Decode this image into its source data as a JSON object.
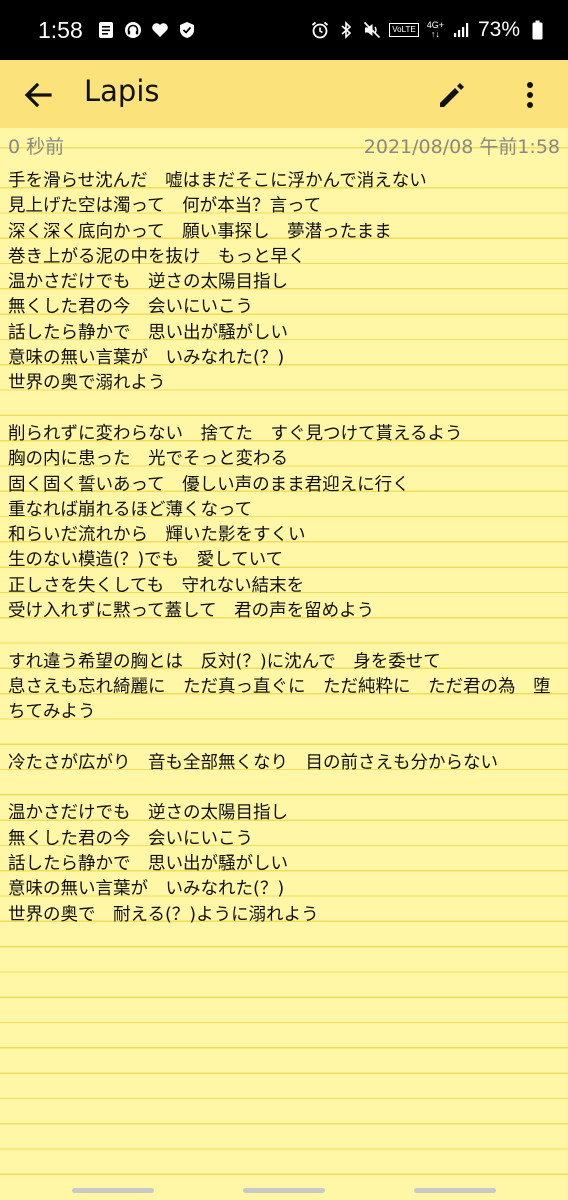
{
  "status_bar": {
    "time": "1:58",
    "battery_text": "73%",
    "volte": "VoLTE",
    "network_type": "4G+",
    "network_arrows": "↑↓",
    "left_icons": [
      "notes-icon",
      "headset-icon",
      "heart-icon",
      "shield-icon"
    ],
    "right_icons": [
      "alarm-icon",
      "bluetooth-icon",
      "mute-icon",
      "signal-icon",
      "battery-icon"
    ]
  },
  "toolbar": {
    "title": "Lapis",
    "bg_color": "#fbe27a"
  },
  "note": {
    "modified": "0 秒前",
    "created": "2021/08/08 午前1:58",
    "bg_color": "#fff7a6",
    "line_color": "#f0dd5a",
    "body": "手を滑らせ沈んだ　嘘はまだそこに浮かんで消えない\n見上げた空は濁って　何が本当？言って\n深く深く底向かって　願い事探し　夢潜ったまま\n巻き上がる泥の中を抜け　もっと早く\n温かさだけでも　逆さの太陽目指し\n無くした君の今　会いにいこう\n話したら静かで　思い出が騒がしい\n意味の無い言葉が　いみなれた(？)\n世界の奥で溺れよう\n\n削られずに変わらない　捨てた　すぐ見つけて貰えるよう\n胸の内に患った　光でそっと変わる\n固く固く誓いあって　優しい声のまま君迎えに行く\n重なれば崩れるほど薄くなって\n和らいだ流れから　輝いた影をすくい\n生のない模造(？)でも　愛していて\n正しさを失くしても　守れない結末を\n受け入れずに黙って蓋して　君の声を留めよう\n\nすれ違う希望の胸とは　反対(？)に沈んで　身を委せて\n息さえも忘れ綺麗に　ただ真っ直ぐに　ただ純粋に　ただ君の為　堕ちてみよう\n\n冷たさが広がり　音も全部無くなり　目の前さえも分からない\n\n温かさだけでも　逆さの太陽目指し\n無くした君の今　会いにいこう\n話したら静かで　思い出が騒がしい\n意味の無い言葉が　いみなれた(？)\n世界の奥で　耐える(？)ように溺れよう"
  },
  "toolbar_icons": {
    "back": "back-arrow-icon",
    "edit": "pencil-icon",
    "more": "more-vert-icon"
  }
}
